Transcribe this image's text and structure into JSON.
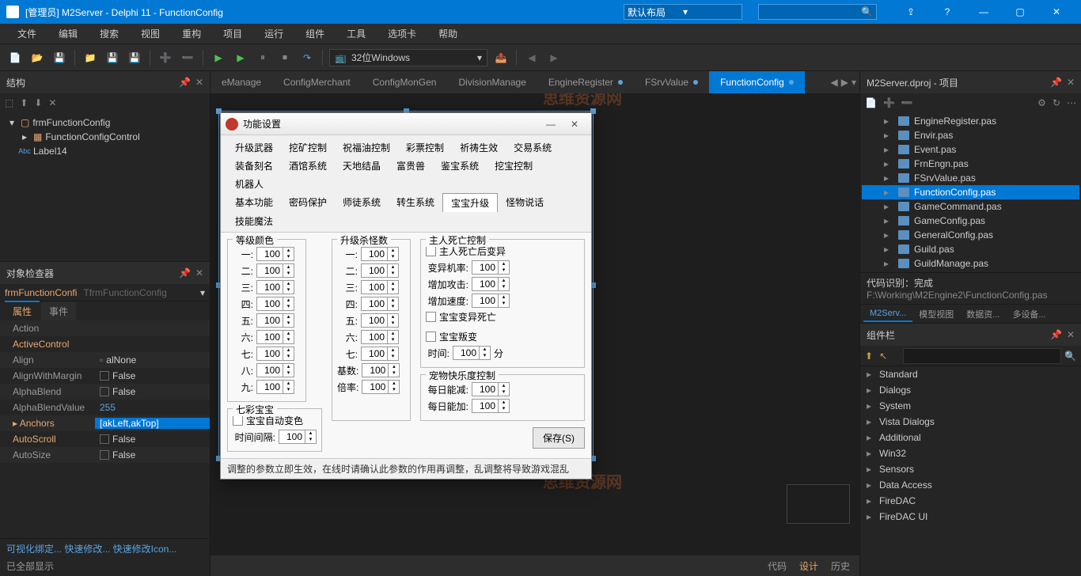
{
  "window": {
    "title": "[管理员] M2Server - Delphi 11 - FunctionConfig",
    "layout_combo": "默认布局"
  },
  "menus": [
    "文件",
    "编辑",
    "搜索",
    "视图",
    "重构",
    "项目",
    "运行",
    "组件",
    "工具",
    "选项卡",
    "帮助"
  ],
  "toolbar": {
    "platform": "32位Windows"
  },
  "structure": {
    "title": "结构",
    "root": "frmFunctionConfig",
    "child1": "FunctionConfigControl",
    "child2": "Label14"
  },
  "inspector": {
    "title": "对象检查器",
    "obj_name": "frmFunctionConfi",
    "obj_class": "TfrmFunctionConfig",
    "tabs": [
      "属性",
      "事件"
    ],
    "props": [
      {
        "name": "Action",
        "val": "",
        "orange": false
      },
      {
        "name": "ActiveControl",
        "val": "",
        "orange": true
      },
      {
        "name": "Align",
        "val": "alNone",
        "orange": false,
        "link": true
      },
      {
        "name": "AlignWithMargin",
        "val": "False",
        "orange": false,
        "cb": true
      },
      {
        "name": "AlphaBlend",
        "val": "False",
        "orange": false,
        "cb": true
      },
      {
        "name": "AlphaBlendValue",
        "val": "255",
        "orange": false,
        "blue": true
      },
      {
        "name": "Anchors",
        "val": "[akLeft,akTop]",
        "orange": true,
        "sel": true,
        "expand": true
      },
      {
        "name": "AutoScroll",
        "val": "False",
        "orange": true,
        "cb": true
      },
      {
        "name": "AutoSize",
        "val": "False",
        "orange": false,
        "cb": true
      }
    ],
    "footer_links": "可视化绑定...  快速修改...  快速修改Icon...",
    "footer_status": "已全部显示"
  },
  "editor_tabs": [
    "eManage",
    "ConfigMerchant",
    "ConfigMonGen",
    "DivisionManage",
    "EngineRegister",
    "FSrvValue",
    "FunctionConfig"
  ],
  "active_tab": 6,
  "form": {
    "title": "功能设置",
    "tab_rows": [
      [
        "升级武器",
        "挖矿控制",
        "祝福油控制",
        "彩票控制",
        "祈祷生效",
        "交易系统"
      ],
      [
        "装备刻名",
        "酒馆系统",
        "天地结晶",
        "富贵兽",
        "鉴宝系统",
        "挖宝控制",
        "机器人"
      ],
      [
        "基本功能",
        "密码保护",
        "师徒系统",
        "转生系统",
        "宝宝升级",
        "怪物说话",
        "技能魔法"
      ]
    ],
    "active_ftab": "宝宝升级",
    "grade_color": {
      "title": "等级颜色",
      "labels": [
        "一:",
        "二:",
        "三:",
        "四:",
        "五:",
        "六:",
        "七:",
        "八:",
        "九:"
      ]
    },
    "upgrade_kill": {
      "title": "升级杀怪数",
      "labels": [
        "一:",
        "二:",
        "三:",
        "四:",
        "五:",
        "六:",
        "七:",
        "基数:",
        "倍率:"
      ]
    },
    "default_val": "100",
    "death": {
      "title": "主人死亡控制",
      "cb1": "主人死亡后变异",
      "rate": "变异机率:",
      "atk": "增加攻击:",
      "spd": "增加速度:",
      "cb2": "宝宝变异死亡",
      "cb3": "宝宝叛变",
      "time": "时间:",
      "unit": "分"
    },
    "happy": {
      "title": "宠物快乐度控制",
      "dec": "每日能减:",
      "inc": "每日能加:"
    },
    "colorful": {
      "title": "七彩宝宝",
      "cb": "宝宝自动变色",
      "interval": "时间间隔:"
    },
    "save_btn": "保存(S)",
    "hint": "调整的参数立即生效，在线时请确认此参数的作用再调整，乱调整将导致游戏混乱"
  },
  "design_tabs": [
    "代码",
    "设计",
    "历史"
  ],
  "project": {
    "title": "M2Server.dproj - 项目",
    "files": [
      "EngineRegister.pas",
      "Envir.pas",
      "Event.pas",
      "FrnEngn.pas",
      "FSrvValue.pas",
      "FunctionConfig.pas",
      "GameCommand.pas",
      "GameConfig.pas",
      "GeneralConfig.pas",
      "Guild.pas",
      "GuildManage.pas"
    ],
    "selected": 5,
    "code_status": "代码识别：完成",
    "path": "F:\\Working\\M2Engine2\\FunctionConfig.pas",
    "tabs": [
      "M2Serv...",
      "模型视图",
      "数据资...",
      "多设备..."
    ]
  },
  "palette": {
    "title": "组件栏",
    "categories": [
      "Standard",
      "Dialogs",
      "System",
      "Vista Dialogs",
      "Additional",
      "Win32",
      "Sensors",
      "Data Access",
      "FireDAC",
      "FireDAC UI"
    ]
  }
}
